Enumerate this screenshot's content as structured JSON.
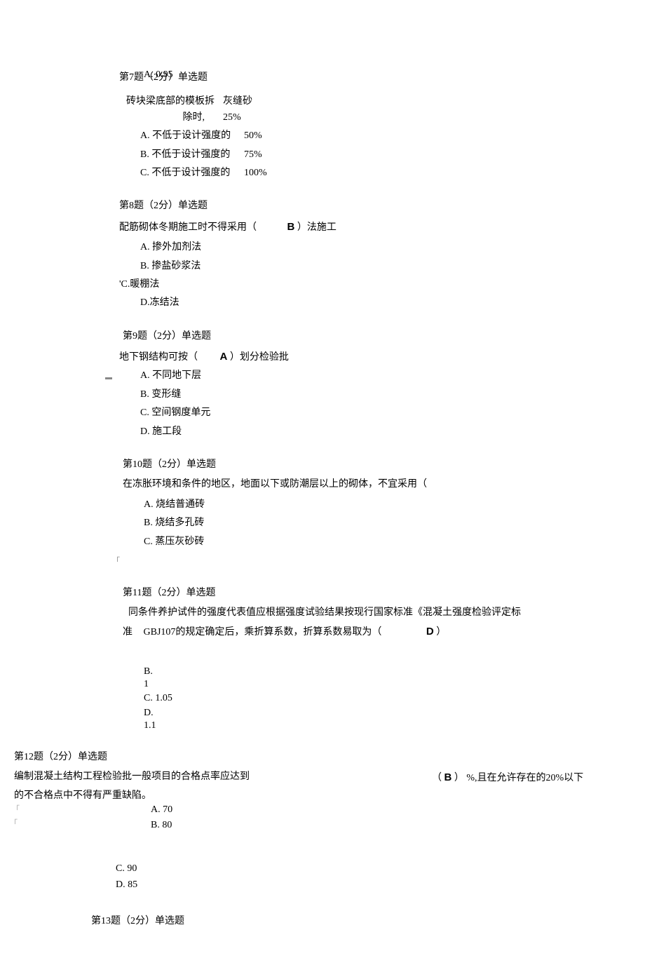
{
  "q7": {
    "title": "第7题（2分）单选题",
    "overlap": "A. 0.95",
    "stem_left1": "砖块梁底部的模板拆",
    "stem_right1": "灰缝砂",
    "stem_left2": "除时,",
    "stem_right2": "25%",
    "optA_left": "A. 不低于设计强度的",
    "optA_right": "50%",
    "optB_left": "B. 不低于设计强度的",
    "optB_right": "75%",
    "optC_left": "C. 不低于设计强度的",
    "optC_right": "100%"
  },
  "q8": {
    "title": "第8题（2分）单选题",
    "stem_pre": "配筋砌体冬期施工时不得采用（",
    "answer": "B",
    "stem_post": "）法施工",
    "optA": "A. 掺外加剂法",
    "optB": "B. 掺盐砂浆法",
    "optC": "'C.暖棚法",
    "optD": "D.冻结法"
  },
  "q9": {
    "title": "第9题（2分）单选题",
    "stem_pre": "地下钢结构可按（",
    "answer": "A",
    "stem_post": "）划分检验批",
    "marker": "▬",
    "optA": "A. 不同地下层",
    "optB": "B. 变形缝",
    "optC": "C. 空间钢度单元",
    "optD": "D. 施工段"
  },
  "q10": {
    "title": "第10题（2分）单选题",
    "stem": "在冻胀环境和条件的地区，地面以下或防潮层以上的砌体，不宜采用（",
    "optA": "A. 烧结普通砖",
    "optB": "B. 烧结多孔砖",
    "optC": "C. 蒸压灰砂砖",
    "marker": "「"
  },
  "q11": {
    "title": "第11题（2分）单选题",
    "stem1": "同条件养护试件的强度代表值应根据强度试验结果按现行国家标准《混凝土强度检验评定标",
    "zhun": "准",
    "stem2": "GBJ107的规定确定后，乘折算系数，折算系数易取为（",
    "answer": "D",
    "stem_post": "）",
    "optB1": "B.",
    "optB2": "1",
    "optC": "C. 1.05",
    "optD1": "D.",
    "optD2": "1.1"
  },
  "q12": {
    "title": "第12题（2分）单选题",
    "stem1": "编制混凝土结构工程检验批一般项目的合格点率应达到",
    "stem_right_pre": "（",
    "answer": "B",
    "stem_right_post": "） %,且在允许存在的20%以下",
    "stem2": "的不合格点中不得有严重缺陷。",
    "marker1": "「",
    "marker2": "「",
    "optA": "A. 70",
    "optB": "B. 80",
    "optC": "C.  90",
    "optD": "D.  85"
  },
  "q13": {
    "title": "第13题（2分）单选题"
  }
}
